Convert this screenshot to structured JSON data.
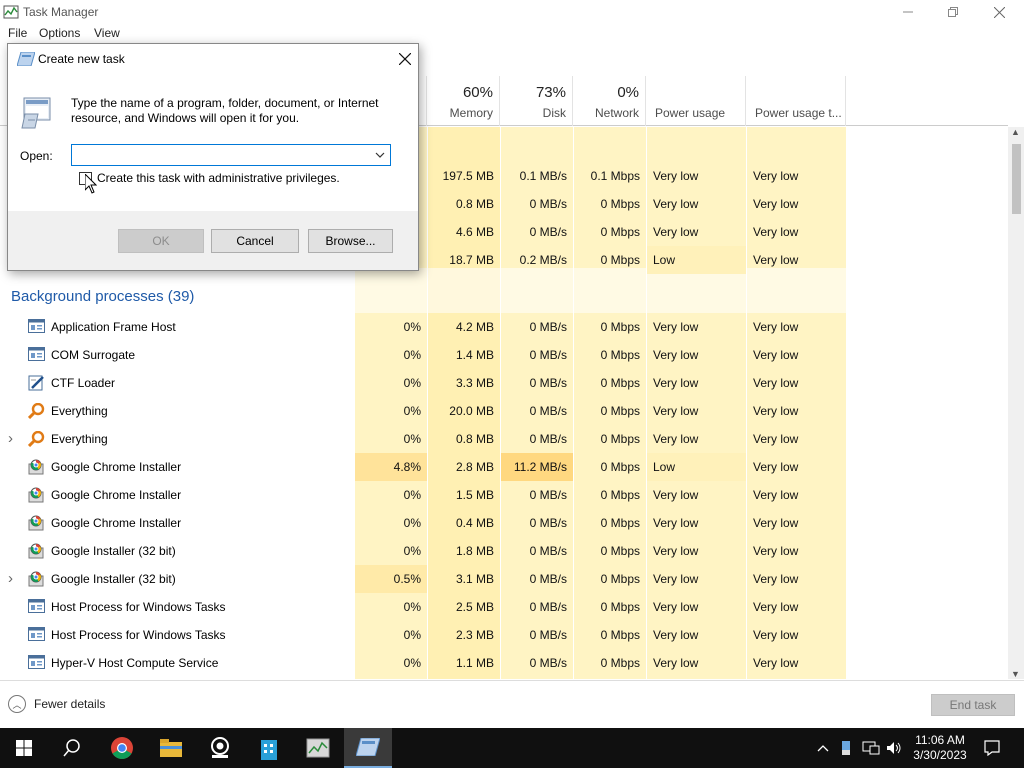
{
  "window": {
    "title": "Task Manager",
    "menu": [
      "File",
      "Options",
      "View"
    ]
  },
  "columns": {
    "cpu": {
      "pct": "",
      "label": ""
    },
    "memory": {
      "pct": "60%",
      "label": "Memory"
    },
    "disk": {
      "pct": "73%",
      "label": "Disk"
    },
    "network": {
      "pct": "0%",
      "label": "Network"
    },
    "power": {
      "label": "Power usage"
    },
    "power_trend": {
      "label": "Power usage t..."
    }
  },
  "top_rows": [
    {
      "cpu": "",
      "memory": "197.5 MB",
      "disk": "0.1 MB/s",
      "network": "0.1 Mbps",
      "power": "Very low",
      "power_trend": "Very low"
    },
    {
      "cpu": "",
      "memory": "0.8 MB",
      "disk": "0 MB/s",
      "network": "0 Mbps",
      "power": "Very low",
      "power_trend": "Very low"
    },
    {
      "cpu": "",
      "memory": "4.6 MB",
      "disk": "0 MB/s",
      "network": "0 Mbps",
      "power": "Very low",
      "power_trend": "Very low"
    },
    {
      "cpu": "",
      "memory": "18.7 MB",
      "disk": "0.2 MB/s",
      "network": "0 Mbps",
      "power": "Low",
      "power_trend": "Very low"
    }
  ],
  "section": {
    "title": "Background processes (39)"
  },
  "processes": [
    {
      "name": "Application Frame Host",
      "icon": "window-icon",
      "expand": false,
      "cpu": "0%",
      "memory": "4.2 MB",
      "disk": "0 MB/s",
      "network": "0 Mbps",
      "power": "Very low",
      "power_trend": "Very low"
    },
    {
      "name": "COM Surrogate",
      "icon": "window-icon",
      "expand": false,
      "cpu": "0%",
      "memory": "1.4 MB",
      "disk": "0 MB/s",
      "network": "0 Mbps",
      "power": "Very low",
      "power_trend": "Very low"
    },
    {
      "name": "CTF Loader",
      "icon": "pen-icon",
      "expand": false,
      "cpu": "0%",
      "memory": "3.3 MB",
      "disk": "0 MB/s",
      "network": "0 Mbps",
      "power": "Very low",
      "power_trend": "Very low"
    },
    {
      "name": "Everything",
      "icon": "magnifier-icon",
      "expand": false,
      "cpu": "0%",
      "memory": "20.0 MB",
      "disk": "0 MB/s",
      "network": "0 Mbps",
      "power": "Very low",
      "power_trend": "Very low"
    },
    {
      "name": "Everything",
      "icon": "magnifier-icon",
      "expand": true,
      "cpu": "0%",
      "memory": "0.8 MB",
      "disk": "0 MB/s",
      "network": "0 Mbps",
      "power": "Very low",
      "power_trend": "Very low"
    },
    {
      "name": "Google Chrome Installer",
      "icon": "installer-icon",
      "expand": false,
      "cpu": "4.8%",
      "memory": "2.8 MB",
      "disk": "11.2 MB/s",
      "network": "0 Mbps",
      "power": "Low",
      "power_trend": "Very low"
    },
    {
      "name": "Google Chrome Installer",
      "icon": "installer-icon",
      "expand": false,
      "cpu": "0%",
      "memory": "1.5 MB",
      "disk": "0 MB/s",
      "network": "0 Mbps",
      "power": "Very low",
      "power_trend": "Very low"
    },
    {
      "name": "Google Chrome Installer",
      "icon": "installer-icon",
      "expand": false,
      "cpu": "0%",
      "memory": "0.4 MB",
      "disk": "0 MB/s",
      "network": "0 Mbps",
      "power": "Very low",
      "power_trend": "Very low"
    },
    {
      "name": "Google Installer (32 bit)",
      "icon": "installer-icon",
      "expand": false,
      "cpu": "0%",
      "memory": "1.8 MB",
      "disk": "0 MB/s",
      "network": "0 Mbps",
      "power": "Very low",
      "power_trend": "Very low"
    },
    {
      "name": "Google Installer (32 bit)",
      "icon": "installer-icon",
      "expand": true,
      "cpu": "0.5%",
      "memory": "3.1 MB",
      "disk": "0 MB/s",
      "network": "0 Mbps",
      "power": "Very low",
      "power_trend": "Very low"
    },
    {
      "name": "Host Process for Windows Tasks",
      "icon": "window-icon",
      "expand": false,
      "cpu": "0%",
      "memory": "2.5 MB",
      "disk": "0 MB/s",
      "network": "0 Mbps",
      "power": "Very low",
      "power_trend": "Very low"
    },
    {
      "name": "Host Process for Windows Tasks",
      "icon": "window-icon",
      "expand": false,
      "cpu": "0%",
      "memory": "2.3 MB",
      "disk": "0 MB/s",
      "network": "0 Mbps",
      "power": "Very low",
      "power_trend": "Very low"
    },
    {
      "name": "Hyper-V Host Compute Service",
      "icon": "window-icon",
      "expand": false,
      "cpu": "0%",
      "memory": "1.1 MB",
      "disk": "0 MB/s",
      "network": "0 Mbps",
      "power": "Very low",
      "power_trend": "Very low"
    }
  ],
  "bottom": {
    "fewer_details": "Fewer details",
    "end_task": "End task"
  },
  "dialog": {
    "title": "Create new task",
    "description": "Type the name of a program, folder, document, or Internet resource, and Windows will open it for you.",
    "open_label": "Open:",
    "open_value": "",
    "admin_checkbox_label": "Create this task with administrative privileges.",
    "ok": "OK",
    "cancel": "Cancel",
    "browse": "Browse..."
  },
  "taskbar": {
    "time": "11:06 AM",
    "date": "3/30/2023",
    "apps": [
      "start-icon",
      "search-icon",
      "chrome-icon",
      "file-explorer-icon",
      "webcam-app-icon",
      "building-app-icon",
      "task-manager-icon",
      "run-dialog-icon"
    ]
  },
  "colors": {
    "cpu_col": "#fff4c4",
    "memory_col": "#fff0b3",
    "hot_cell": "#ffd880",
    "low_power": "#fff1ba",
    "section_blue": "#1f5aa8"
  }
}
